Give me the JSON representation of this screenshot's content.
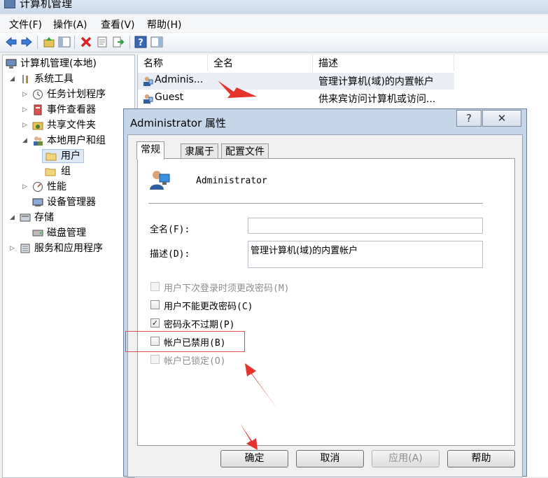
{
  "window": {
    "title": "计算机管理"
  },
  "menubar": {
    "items": [
      "文件(F)",
      "操作(A)",
      "查看(V)",
      "帮助(H)"
    ]
  },
  "toolbar": {
    "icons": [
      "back-arrow-icon",
      "forward-arrow-icon",
      "up-folder-icon",
      "show-tree-icon",
      "delete-icon",
      "properties-icon",
      "export-icon",
      "help-icon",
      "action-pane-icon"
    ]
  },
  "tree": [
    {
      "label": "计算机管理(本地)",
      "icon": "computer-management-icon"
    },
    {
      "label": "系统工具",
      "icon": "tools-icon"
    },
    {
      "label": "任务计划程序",
      "icon": "clock-icon"
    },
    {
      "label": "事件查看器",
      "icon": "event-viewer-icon"
    },
    {
      "label": "共享文件夹",
      "icon": "shared-folder-icon"
    },
    {
      "label": "本地用户和组",
      "icon": "users-icon"
    },
    {
      "label": "用户",
      "icon": "folder-icon"
    },
    {
      "label": "组",
      "icon": "folder-icon"
    },
    {
      "label": "性能",
      "icon": "performance-icon"
    },
    {
      "label": "设备管理器",
      "icon": "device-manager-icon"
    },
    {
      "label": "存储",
      "icon": "storage-icon"
    },
    {
      "label": "磁盘管理",
      "icon": "disk-icon"
    },
    {
      "label": "服务和应用程序",
      "icon": "services-icon"
    }
  ],
  "list": {
    "columns": [
      "名称",
      "全名",
      "描述"
    ],
    "rows": [
      {
        "name": "Adminis...",
        "fullname": "",
        "desc": "管理计算机(域)的内置帐户"
      },
      {
        "name": "Guest",
        "fullname": "",
        "desc": "供来宾访问计算机或访问..."
      }
    ]
  },
  "dialog": {
    "title": "Administrator 属性",
    "help_glyph": "?",
    "close_glyph": "✕",
    "tabs": [
      "常规",
      "隶属于",
      "配置文件"
    ],
    "username": "Administrator",
    "fullname_label": "全名(F):",
    "fullname_value": "",
    "desc_label": "描述(D):",
    "desc_value": "管理计算机(域)的内置帐户",
    "checkboxes": [
      {
        "label": "用户下次登录时须更改密码(M)",
        "checked": false,
        "enabled": false
      },
      {
        "label": "用户不能更改密码(C)",
        "checked": false,
        "enabled": true
      },
      {
        "label": "密码永不过期(P)",
        "checked": true,
        "enabled": true
      },
      {
        "label": "帐户已禁用(B)",
        "checked": false,
        "enabled": true
      },
      {
        "label": "帐户已锁定(O)",
        "checked": false,
        "enabled": false
      }
    ],
    "check_glyph": "✓",
    "buttons": [
      "确定",
      "取消",
      "应用(A)",
      "帮助"
    ]
  },
  "annotation_color": "#e5322d"
}
